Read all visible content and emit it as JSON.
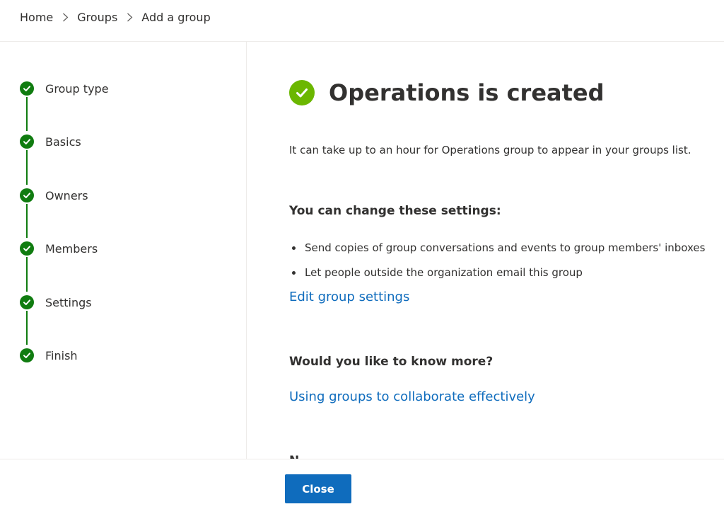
{
  "breadcrumb": {
    "items": [
      "Home",
      "Groups",
      "Add a group"
    ],
    "separator_icon": "chevron-right-icon"
  },
  "stepper": {
    "status_icon": "check-circle-icon",
    "color": "#107c10",
    "steps": [
      {
        "label": "Group type",
        "status": "complete"
      },
      {
        "label": "Basics",
        "status": "complete"
      },
      {
        "label": "Owners",
        "status": "complete"
      },
      {
        "label": "Members",
        "status": "complete"
      },
      {
        "label": "Settings",
        "status": "complete"
      },
      {
        "label": "Finish",
        "status": "complete"
      }
    ]
  },
  "main": {
    "title": "Operations is created",
    "title_icon": "success-check-icon",
    "success_color": "#6bb700",
    "info": "It can take up to an hour for Operations group to appear in your groups list.",
    "settings_heading": "You can change these settings:",
    "settings_items": [
      "Send copies of group conversations and events to group members' inboxes",
      "Let people outside the organization email this group"
    ],
    "edit_link": "Edit group settings",
    "more_heading": "Would you like to know more?",
    "more_link": "Using groups to collaborate effectively",
    "link_color": "#0f6cbd"
  },
  "footer": {
    "close_label": "Close",
    "button_color": "#0f6cbd"
  }
}
